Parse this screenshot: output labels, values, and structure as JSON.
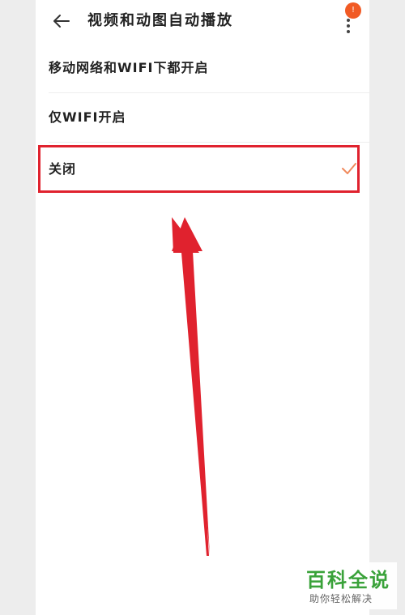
{
  "header": {
    "title": "视频和动图自动播放",
    "badge_text": "!"
  },
  "options": [
    {
      "label": "移动网络和WIFI下都开启",
      "selected": false
    },
    {
      "label": "仅WIFI开启",
      "selected": false
    },
    {
      "label": "关闭",
      "selected": true
    }
  ],
  "colors": {
    "accent": "#f15a24",
    "highlight": "#e0222e",
    "check": "#f08a5d"
  },
  "watermark": {
    "title": "百科全说",
    "subtitle": "助你轻松解决"
  }
}
